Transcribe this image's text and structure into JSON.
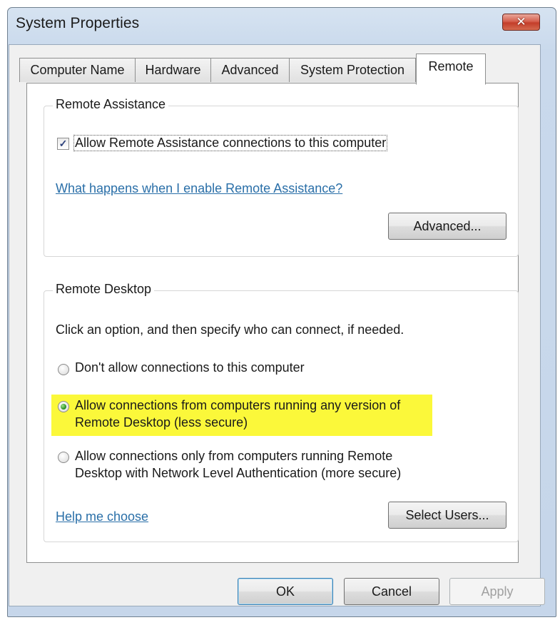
{
  "window": {
    "title": "System Properties",
    "close_glyph": "✕"
  },
  "tabs": [
    {
      "label": "Computer Name",
      "active": false
    },
    {
      "label": "Hardware",
      "active": false
    },
    {
      "label": "Advanced",
      "active": false
    },
    {
      "label": "System Protection",
      "active": false
    },
    {
      "label": "Remote",
      "active": true
    }
  ],
  "remote_assistance": {
    "group_label": "Remote Assistance",
    "checkbox_checked": true,
    "checkbox_mark": "✓",
    "checkbox_label": "Allow Remote Assistance connections to this computer",
    "help_link": "What happens when I enable Remote Assistance?",
    "advanced_button": "Advanced..."
  },
  "remote_desktop": {
    "group_label": "Remote Desktop",
    "instruction": "Click an option, and then specify who can connect, if needed.",
    "options": [
      {
        "line1": "Don't allow connections to this computer",
        "line2": "",
        "selected": false
      },
      {
        "line1": "Allow connections from computers running any version of",
        "line2": "Remote Desktop (less secure)",
        "selected": true,
        "highlighted": true
      },
      {
        "line1": "Allow connections only from computers running Remote",
        "line2": "Desktop with Network Level Authentication (more secure)",
        "selected": false
      }
    ],
    "help_link": "Help me choose",
    "select_users_button": "Select Users..."
  },
  "footer": {
    "ok": "OK",
    "cancel": "Cancel",
    "apply": "Apply",
    "apply_enabled": false
  },
  "colors": {
    "highlight": "#fbf83a",
    "link": "#2a6fa8",
    "close_button": "#c33d2a"
  }
}
